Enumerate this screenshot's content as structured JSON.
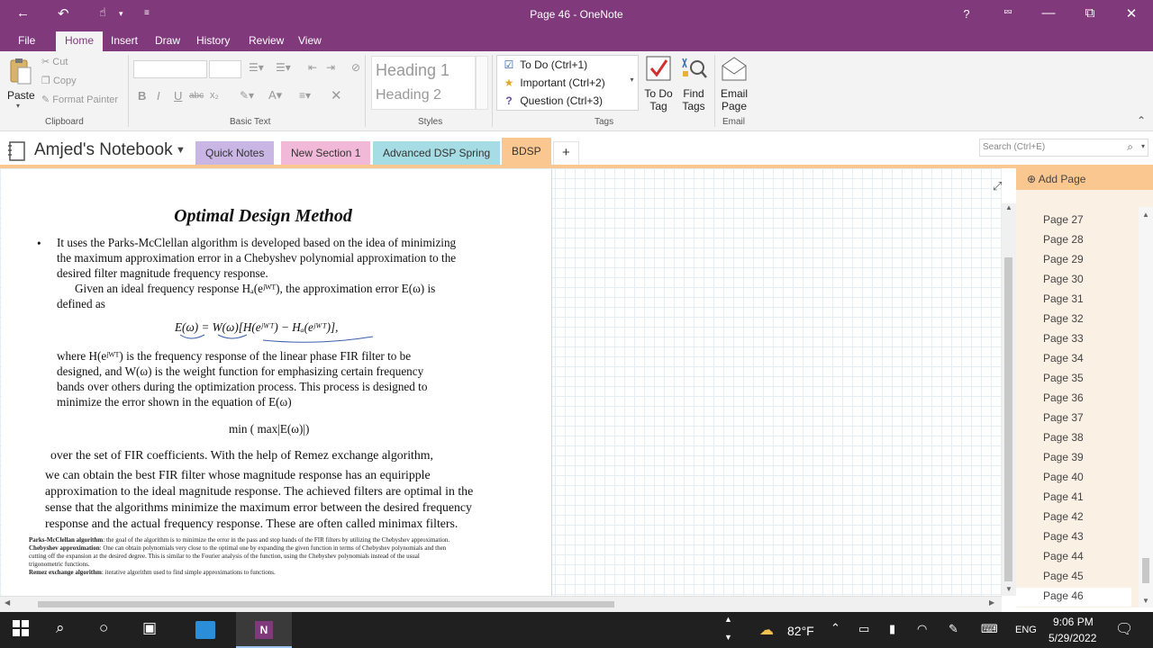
{
  "window": {
    "title": "Page 46 - OneNote",
    "help": "?",
    "restore_icon": "⧉"
  },
  "menu_tabs": [
    "File",
    "Home",
    "Insert",
    "Draw",
    "History",
    "Review",
    "View"
  ],
  "ribbon": {
    "clipboard": {
      "paste": "Paste",
      "cut": "Cut",
      "copy": "Copy",
      "format_painter": "Format Painter",
      "label": "Clipboard"
    },
    "basic_text": {
      "label": "Basic Text",
      "bold": "B",
      "italic": "I",
      "underline": "U",
      "strike": "abc",
      "subscript": "x₂"
    },
    "styles": {
      "heading1": "Heading 1",
      "heading2": "Heading 2",
      "label": "Styles"
    },
    "tags": {
      "items": [
        {
          "label": "To Do (Ctrl+1)",
          "icon": "checkbox-icon"
        },
        {
          "label": "Important (Ctrl+2)",
          "icon": "star-icon"
        },
        {
          "label": "Question (Ctrl+3)",
          "icon": "question-icon"
        }
      ],
      "todo_tag": [
        "To Do",
        "Tag"
      ],
      "find_tags": [
        "Find",
        "Tags"
      ],
      "label": "Tags"
    },
    "email": {
      "button": [
        "Email",
        "Page"
      ],
      "label": "Email"
    }
  },
  "notebook": {
    "name": "Amjed's Notebook",
    "sections": [
      {
        "label": "Quick Notes",
        "color": "#c9b6e4"
      },
      {
        "label": "New Section 1",
        "color": "#f1b8d8"
      },
      {
        "label": "Advanced DSP Spring",
        "color": "#a6dde4"
      },
      {
        "label": "BDSP",
        "color": "#fbc790"
      }
    ],
    "add_section": "+",
    "search_placeholder": "Search (Ctrl+E)"
  },
  "document": {
    "title": "Optimal Design Method",
    "paragraph1": [
      "It uses the Parks-McClellan algorithm is developed based on the idea of minimizing",
      "the maximum approximation error in a Chebyshev polynomial approximation to the",
      "desired filter magnitude frequency response."
    ],
    "given_line1": "Given an ideal frequency response Hₐ(eʲᵂᵀ), the approximation error E(ω) is",
    "given_line2": "defined as",
    "equation": "E(ω) = W(ω)[H(eʲᵂᵀ) − Hₐ(eʲᵂᵀ)],",
    "where_lines": [
      "where H(eʲᵂᵀ) is the frequency response of the linear phase FIR filter to be",
      "designed, and W(ω) is the weight function for emphasizing certain frequency",
      "bands over others during the optimization process. This process is designed to",
      "minimize the error shown in the equation of E(ω)"
    ],
    "minmax": "min ( max|E(ω)|)",
    "body_lines": [
      "over the set of FIR coefficients. With the help of Remez exchange algorithm,",
      "we can obtain the best FIR filter whose magnitude response has an equiripple",
      "approximation to the ideal magnitude response. The achieved filters are optimal in the",
      "sense that the algorithms minimize the maximum error between the desired frequency",
      "response and the actual frequency response. These are often called minimax filters."
    ],
    "footnotes": [
      {
        "term": "Parks-McClellan algorithm",
        "text": ": the goal of the algorithm is to minimize the error in the pass and stop bands of the FIR filters by utilizing the Chebyshev approximation."
      },
      {
        "term": "Chebyshev approximation",
        "text": ": One can obtain polynomials very close to the optimal one by expanding the given function in terms of Chebyshev polynomials and then"
      },
      {
        "term": "",
        "text": "cutting off the expansion at the desired degree. This is similar to the Fourier analysis of the function, using the Chebyshev polynomials instead of the usual"
      },
      {
        "term": "",
        "text": "trigonometric functions."
      },
      {
        "term": "Remez exchange algorithm",
        "text": ": iterative algorithm used to find simple approximations to functions."
      }
    ]
  },
  "pages": {
    "add_page": "Add Page",
    "items": [
      "Page 27",
      "Page 28",
      "Page 29",
      "Page 30",
      "Page 31",
      "Page 32",
      "Page 33",
      "Page 34",
      "Page 35",
      "Page 36",
      "Page 37",
      "Page 38",
      "Page 39",
      "Page 40",
      "Page 41",
      "Page 42",
      "Page 43",
      "Page 44",
      "Page 45",
      "Page 46"
    ],
    "selected": "Page 46"
  },
  "taskbar": {
    "weather": "82°F",
    "language": "ENG",
    "time": "9:06 PM",
    "date": "5/29/2022"
  }
}
